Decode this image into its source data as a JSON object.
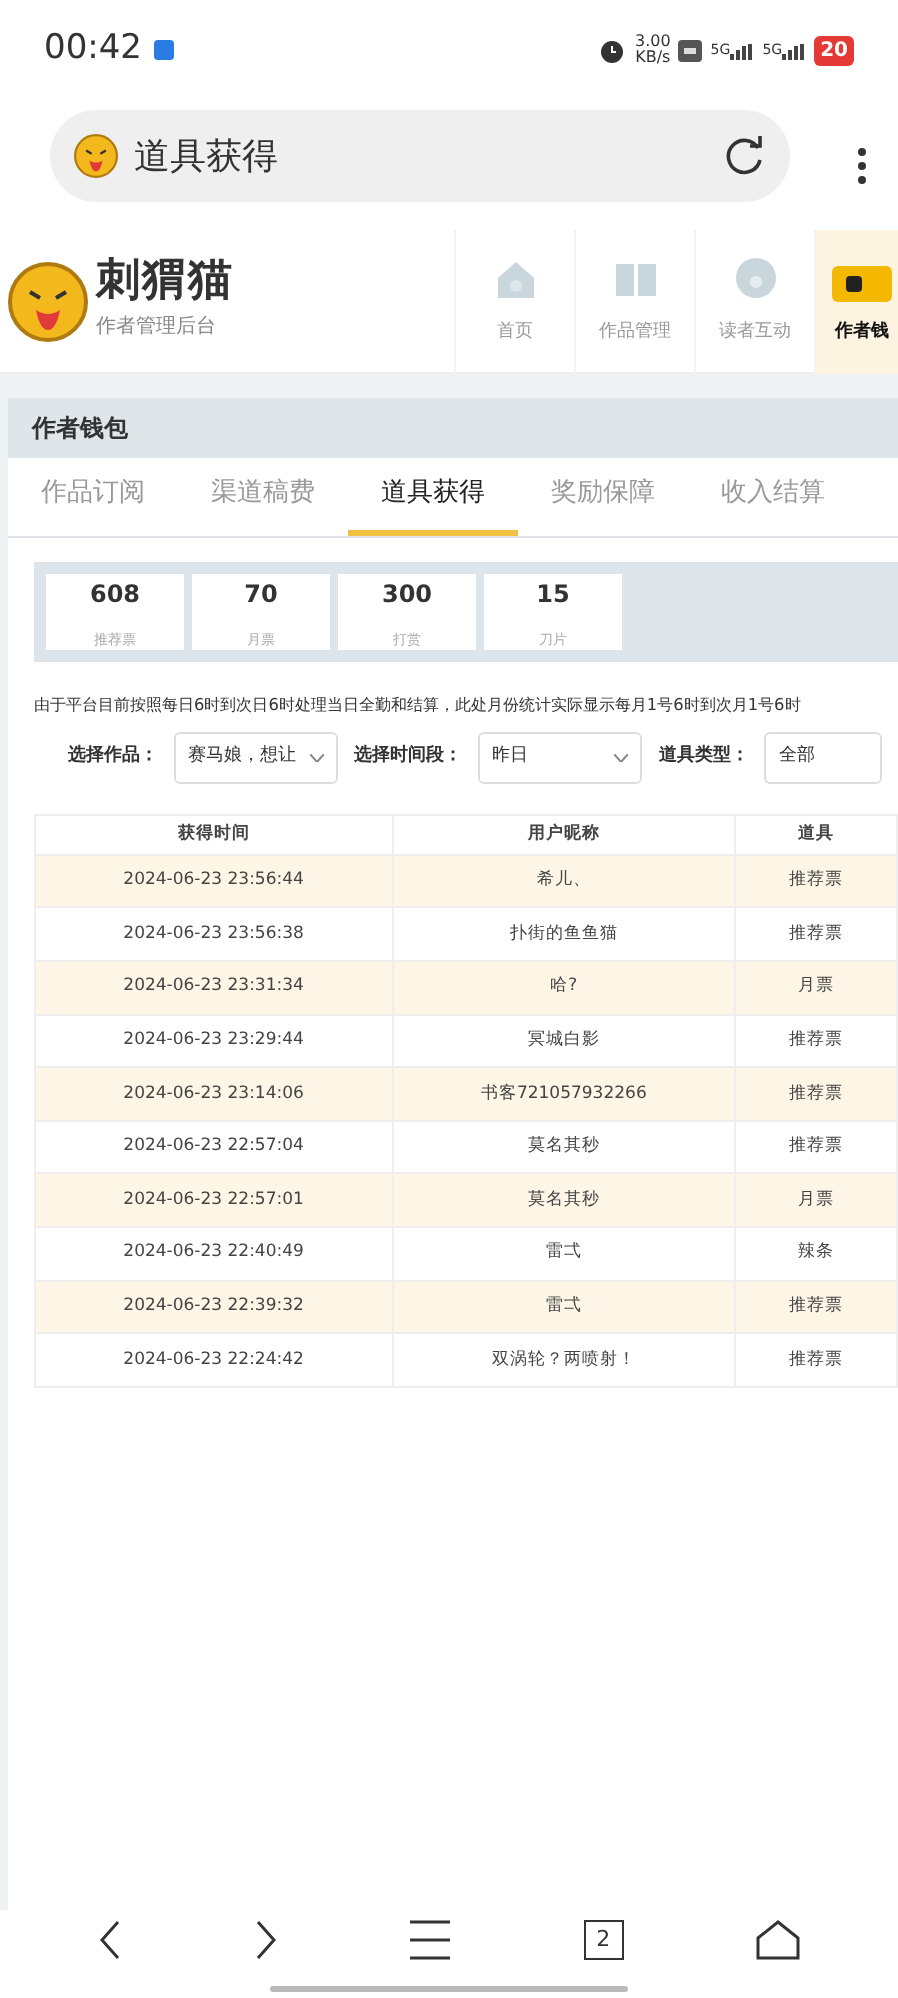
{
  "status_bar": {
    "time": "00:42",
    "speed_value": "3.00",
    "speed_unit": "KB/s",
    "network_1": "5G",
    "network_2": "5G",
    "battery": "20"
  },
  "address_bar": {
    "title": "道具获得"
  },
  "header": {
    "logo_name": "刺猬猫",
    "logo_subtitle": "作者管理后台",
    "nav": [
      {
        "label": "首页",
        "selected": false,
        "kind": "house"
      },
      {
        "label": "作品管理",
        "selected": false,
        "kind": "book"
      },
      {
        "label": "读者互动",
        "selected": false,
        "kind": "chat"
      },
      {
        "label": "作者钱",
        "selected": true,
        "kind": "wallet"
      }
    ]
  },
  "panel": {
    "title": "作者钱包",
    "tabs": [
      {
        "label": "作品订阅",
        "selected": false
      },
      {
        "label": "渠道稿费",
        "selected": false
      },
      {
        "label": "道具获得",
        "selected": true
      },
      {
        "label": "奖励保障",
        "selected": false
      },
      {
        "label": "收入结算",
        "selected": false
      }
    ],
    "stats": [
      {
        "value": "608",
        "label": "推荐票"
      },
      {
        "value": "70",
        "label": "月票"
      },
      {
        "value": "300",
        "label": "打赏"
      },
      {
        "value": "15",
        "label": "刀片"
      }
    ],
    "notice": "由于平台目前按照每日6时到次日6时处理当日全勤和结算，此处月份统计实际显示每月1号6时到次月1号6时",
    "filters": [
      {
        "label": "选择作品：",
        "value": "赛马娘，想让"
      },
      {
        "label": "选择时间段：",
        "value": "昨日"
      },
      {
        "label": "道具类型：",
        "value": "全部"
      }
    ],
    "table": {
      "columns": [
        "获得时间",
        "用户昵称",
        "道具"
      ],
      "rows": [
        [
          "2024-06-23 23:56:44",
          "希儿、",
          "推荐票"
        ],
        [
          "2024-06-23 23:56:38",
          "扑街的鱼鱼猫",
          "推荐票"
        ],
        [
          "2024-06-23 23:31:34",
          "哈?",
          "月票"
        ],
        [
          "2024-06-23 23:29:44",
          "冥城白影",
          "推荐票"
        ],
        [
          "2024-06-23 23:14:06",
          "书客721057932266",
          "推荐票"
        ],
        [
          "2024-06-23 22:57:04",
          "莫名其秒",
          "推荐票"
        ],
        [
          "2024-06-23 22:57:01",
          "莫名其秒",
          "月票"
        ],
        [
          "2024-06-23 22:40:49",
          "雷弌",
          "辣条"
        ],
        [
          "2024-06-23 22:39:32",
          "雷弌",
          "推荐票"
        ],
        [
          "2024-06-23 22:24:42",
          "双涡轮？两喷射！",
          "推荐票"
        ]
      ]
    }
  },
  "bottom_nav": {
    "tab_count": "2"
  }
}
